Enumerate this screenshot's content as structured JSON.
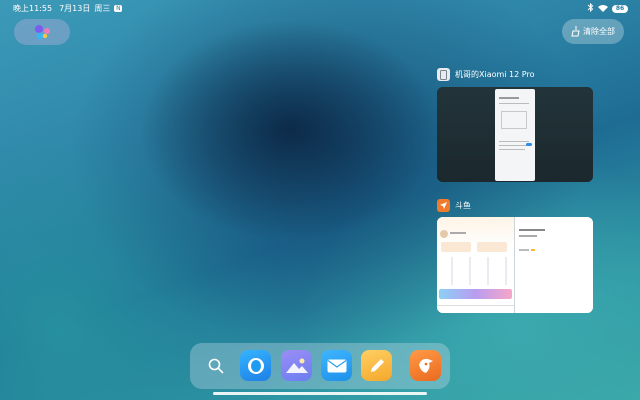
{
  "status_bar": {
    "time": "晚上11:55",
    "date": "7月13日",
    "weekday": "周三",
    "notification_badge": "N",
    "battery": "86"
  },
  "assistant_pill": {
    "icon": "assistant-dots-icon"
  },
  "clear_all": {
    "label": "清除全部",
    "icon": "broom-icon"
  },
  "recent_apps": [
    {
      "title": "机哥的Xiaomi 12 Pro",
      "icon": "phone-icon"
    },
    {
      "title": "斗鱼",
      "icon": "douyu-icon"
    }
  ],
  "dock": {
    "items": [
      {
        "name": "search",
        "icon": "search-icon"
      },
      {
        "name": "browser",
        "icon": "browser-icon",
        "color": "#1e9bf0"
      },
      {
        "name": "gallery",
        "icon": "gallery-icon",
        "color": "#7a6cf0"
      },
      {
        "name": "mail",
        "icon": "mail-icon",
        "color": "#2aa0ee"
      },
      {
        "name": "notes",
        "icon": "notes-icon",
        "color": "#f6b73a"
      },
      {
        "name": "douyu",
        "icon": "douyu-icon",
        "color": "#f07b2b"
      }
    ]
  }
}
